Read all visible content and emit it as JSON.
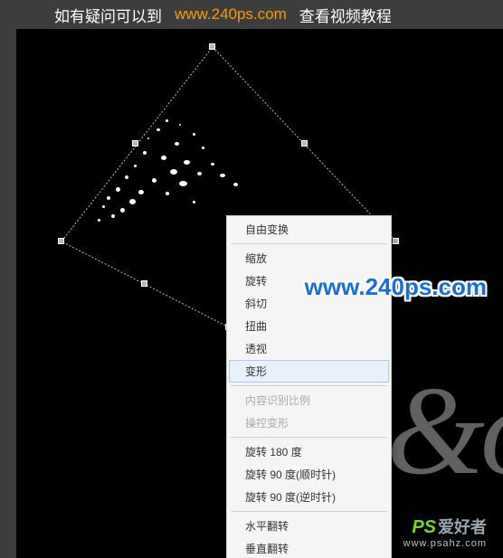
{
  "banner": {
    "text1": "如有疑问可以到",
    "link": "www.240ps.com",
    "text2": "查看视频教程"
  },
  "script_bg": "&o",
  "menu": {
    "title": "自由变换",
    "items": [
      {
        "label": "缩放",
        "type": "item"
      },
      {
        "label": "旋转",
        "type": "item"
      },
      {
        "label": "斜切",
        "type": "item"
      },
      {
        "label": "扭曲",
        "type": "item"
      },
      {
        "label": "透视",
        "type": "item"
      },
      {
        "label": "变形",
        "type": "highlighted"
      },
      {
        "type": "sep"
      },
      {
        "label": "内容识别比例",
        "type": "disabled"
      },
      {
        "label": "操控变形",
        "type": "disabled"
      },
      {
        "type": "sep"
      },
      {
        "label": "旋转 180 度",
        "type": "item"
      },
      {
        "label": "旋转 90 度(顺时针)",
        "type": "item"
      },
      {
        "label": "旋转 90 度(逆时针)",
        "type": "item"
      },
      {
        "type": "sep"
      },
      {
        "label": "水平翻转",
        "type": "item"
      },
      {
        "label": "垂直翻转",
        "type": "item"
      }
    ]
  },
  "watermark_url": "www.240ps.com",
  "logo": {
    "ps": "PS",
    "chinese": "爱好者",
    "domain": "www.psahz.com"
  }
}
